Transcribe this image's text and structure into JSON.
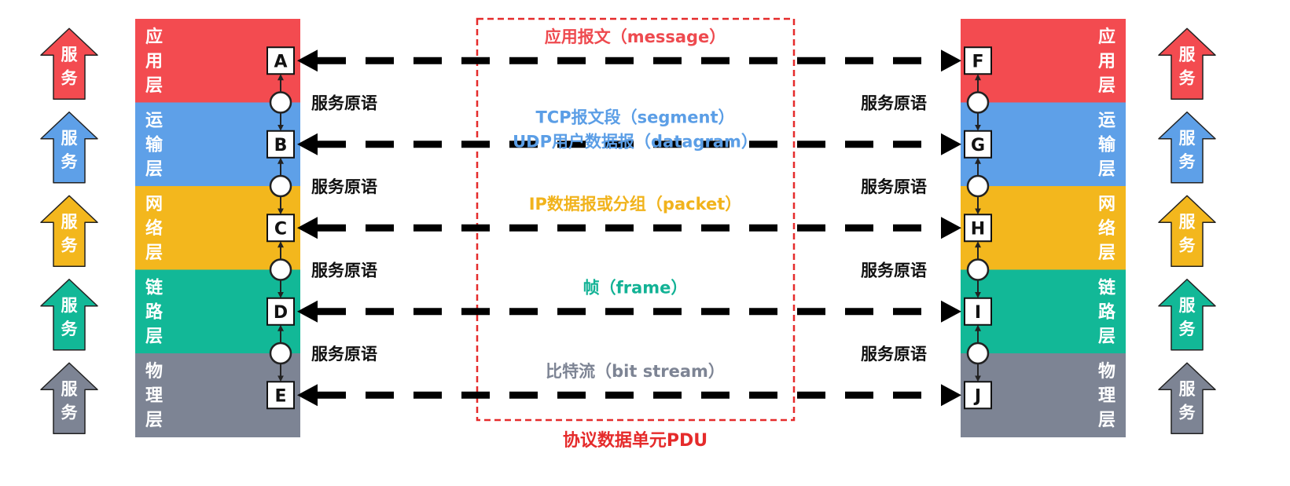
{
  "colors": {
    "application": "#f34b50",
    "transport": "#5ea0e8",
    "network": "#f3b71d",
    "link": "#12b897",
    "physical": "#7d8494",
    "frame_red": "#e52b2b",
    "dark": "#222222"
  },
  "service_label": "服务",
  "primitive_label": "服务原语",
  "pdu_label": "协议数据单元PDU",
  "layers": [
    {
      "id": "application",
      "name": "应用层",
      "left_box": "A",
      "right_box": "F",
      "color": "#f34b50",
      "pdu_lines": [
        "应用报文（message）"
      ],
      "pdu_color": "#ee4a4f"
    },
    {
      "id": "transport",
      "name": "运输层",
      "left_box": "B",
      "right_box": "G",
      "color": "#5ea0e8",
      "pdu_lines": [
        "TCP报文段（segment）",
        "UDP用户数据报（datagram）"
      ],
      "pdu_color": "#5b9ee6"
    },
    {
      "id": "network",
      "name": "网络层",
      "left_box": "C",
      "right_box": "H",
      "color": "#f3b71d",
      "pdu_lines": [
        "IP数据报或分组（packet）"
      ],
      "pdu_color": "#f1b31c"
    },
    {
      "id": "link",
      "name": "链路层",
      "left_box": "D",
      "right_box": "I",
      "color": "#12b897",
      "pdu_lines": [
        "帧（frame）"
      ],
      "pdu_color": "#12b295"
    },
    {
      "id": "physical",
      "name": "物理层",
      "left_box": "E",
      "right_box": "J",
      "color": "#7d8494",
      "pdu_lines": [
        "比特流（bit stream）"
      ],
      "pdu_color": "#7d8494"
    }
  ]
}
